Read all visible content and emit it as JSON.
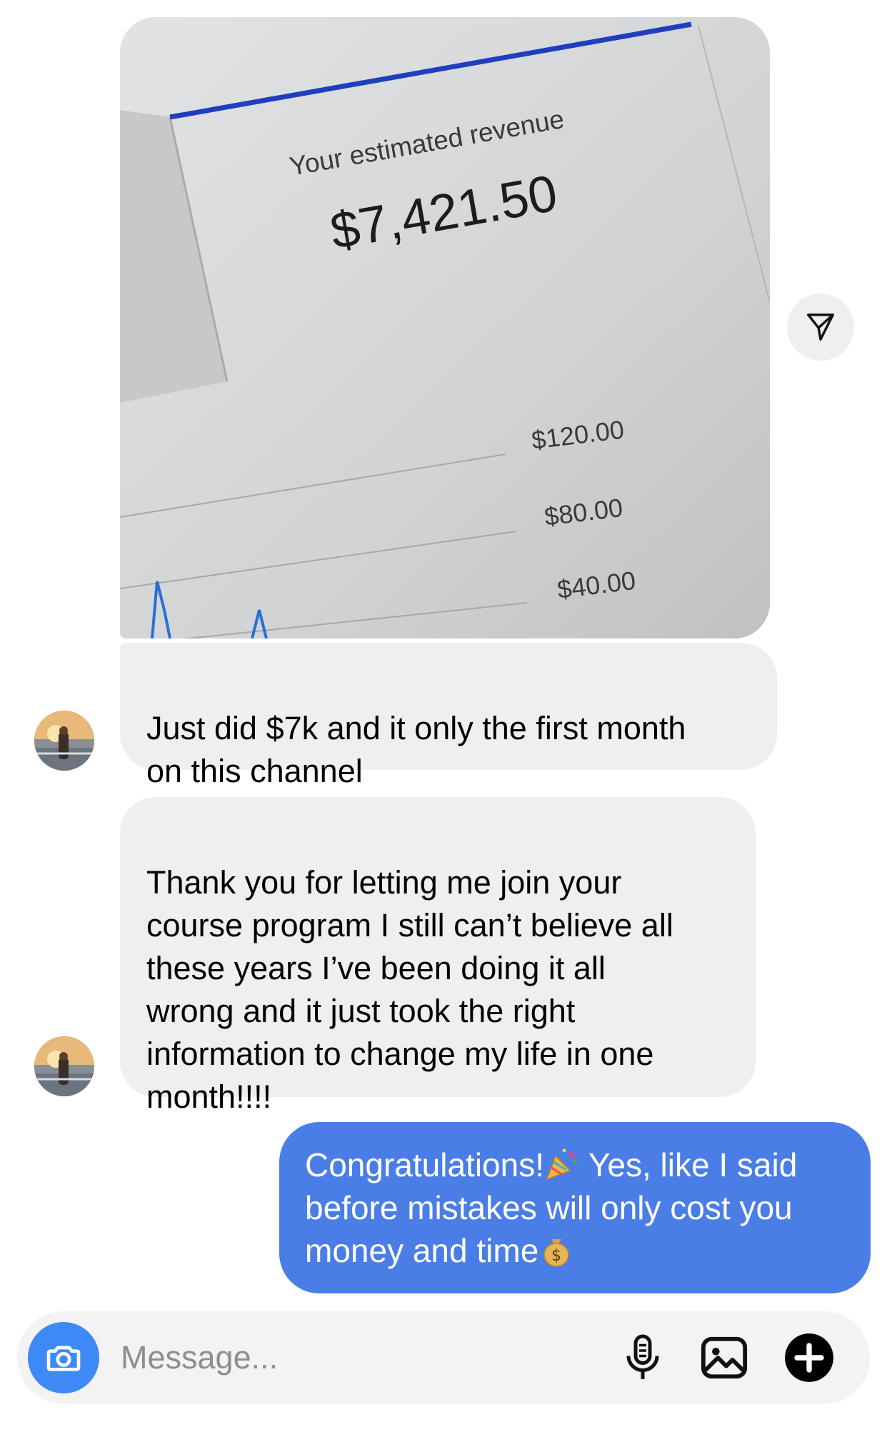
{
  "photo": {
    "revenue_title": "Your estimated revenue",
    "revenue_amount": "$7,421.50",
    "tick_labels": [
      "$120.00",
      "$80.00",
      "$40.00"
    ]
  },
  "messages": [
    {
      "direction": "received",
      "text": "Just did $7k and it only the first month\non this channel"
    },
    {
      "direction": "received",
      "text": "Thank you for letting me join your\ncourse program I still can’t believe all\nthese years I’ve been doing it all\nwrong and it just took the right\ninformation to change my life in one\nmonth!!!!"
    },
    {
      "direction": "sent",
      "part1": "Congratulations!",
      "emoji1": "party-popper",
      "part2": " Yes, like I said before mistakes will only cost you money and time",
      "emoji2": "money-bag"
    }
  ],
  "composer": {
    "placeholder": "Message..."
  },
  "colors": {
    "sent_bubble": "#4a7ee6",
    "received_bubble": "#efefef",
    "camera_button": "#3d8af7"
  },
  "icons": {
    "share": "paper-plane-icon",
    "camera": "camera-icon",
    "mic": "microphone-icon",
    "gallery": "image-icon",
    "add": "plus-icon"
  }
}
